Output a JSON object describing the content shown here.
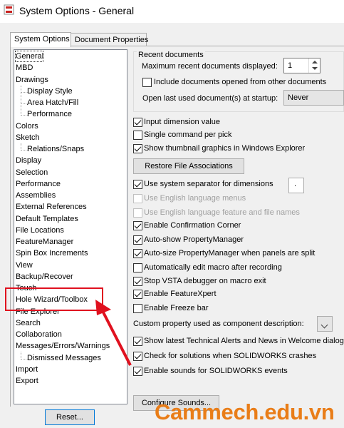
{
  "window": {
    "title": "System Options - General"
  },
  "tabs": [
    {
      "label": "System Options",
      "active": true
    },
    {
      "label": "Document Properties",
      "active": false
    }
  ],
  "tree": [
    {
      "label": "General",
      "level": 0,
      "selected": true
    },
    {
      "label": "MBD",
      "level": 0
    },
    {
      "label": "Drawings",
      "level": 0
    },
    {
      "label": "Display Style",
      "level": 1
    },
    {
      "label": "Area Hatch/Fill",
      "level": 1
    },
    {
      "label": "Performance",
      "level": 1
    },
    {
      "label": "Colors",
      "level": 0
    },
    {
      "label": "Sketch",
      "level": 0
    },
    {
      "label": "Relations/Snaps",
      "level": 1
    },
    {
      "label": "Display",
      "level": 0
    },
    {
      "label": "Selection",
      "level": 0
    },
    {
      "label": "Performance",
      "level": 0
    },
    {
      "label": "Assemblies",
      "level": 0
    },
    {
      "label": "External References",
      "level": 0
    },
    {
      "label": "Default Templates",
      "level": 0
    },
    {
      "label": "File Locations",
      "level": 0
    },
    {
      "label": "FeatureManager",
      "level": 0
    },
    {
      "label": "Spin Box Increments",
      "level": 0
    },
    {
      "label": "View",
      "level": 0
    },
    {
      "label": "Backup/Recover",
      "level": 0
    },
    {
      "label": "Touch",
      "level": 0
    },
    {
      "label": "Hole Wizard/Toolbox",
      "level": 0,
      "highlighted": true
    },
    {
      "label": "File Explorer",
      "level": 0
    },
    {
      "label": "Search",
      "level": 0
    },
    {
      "label": "Collaboration",
      "level": 0
    },
    {
      "label": "Messages/Errors/Warnings",
      "level": 0
    },
    {
      "label": "Dismissed Messages",
      "level": 1
    },
    {
      "label": "Import",
      "level": 0
    },
    {
      "label": "Export",
      "level": 0
    }
  ],
  "reset_button": "Reset...",
  "recent_documents": {
    "legend": "Recent documents",
    "max_label": "Maximum recent documents displayed:",
    "max_value": "1",
    "include_label": "Include documents opened from other documents",
    "include_checked": false,
    "open_last_label": "Open last used document(s) at startup:",
    "open_last_value": "Never"
  },
  "options": [
    {
      "label": "Input dimension value",
      "checked": true,
      "enabled": true
    },
    {
      "label": "Single command per pick",
      "checked": false,
      "enabled": true
    },
    {
      "label": "Show thumbnail graphics in Windows Explorer",
      "checked": true,
      "enabled": true
    }
  ],
  "restore_button": "Restore File Associations",
  "options2": [
    {
      "label": "Use system separator for dimensions",
      "checked": true,
      "enabled": true
    },
    {
      "label": "Use English language menus",
      "checked": false,
      "enabled": false
    },
    {
      "label": "Use English language feature and file names",
      "checked": false,
      "enabled": false
    },
    {
      "label": "Enable Confirmation Corner",
      "checked": true,
      "enabled": true
    },
    {
      "label": "Auto-show PropertyManager",
      "checked": true,
      "enabled": true
    },
    {
      "label": "Auto-size PropertyManager when panels are split",
      "checked": true,
      "enabled": true
    },
    {
      "label": "Automatically edit macro after recording",
      "checked": false,
      "enabled": true
    },
    {
      "label": "Stop VSTA debugger on macro exit",
      "checked": true,
      "enabled": true
    },
    {
      "label": "Enable FeatureXpert",
      "checked": true,
      "enabled": true
    },
    {
      "label": "Enable Freeze bar",
      "checked": false,
      "enabled": true
    }
  ],
  "separator_value": ".",
  "custom_property_label": "Custom property used as component description:",
  "options3": [
    {
      "label": "Show latest Technical Alerts and News in Welcome dialog",
      "checked": true,
      "enabled": true
    },
    {
      "label": "Check for solutions when SOLIDWORKS crashes",
      "checked": true,
      "enabled": true
    },
    {
      "label": "Enable sounds for SOLIDWORKS events",
      "checked": true,
      "enabled": true
    }
  ],
  "configure_sounds_button": "Configure Sounds...",
  "watermark": "Cammech.edu.vn",
  "colors": {
    "highlight": "#e0111f",
    "watermark": "#e97d18",
    "focus_border": "#0078d7"
  }
}
